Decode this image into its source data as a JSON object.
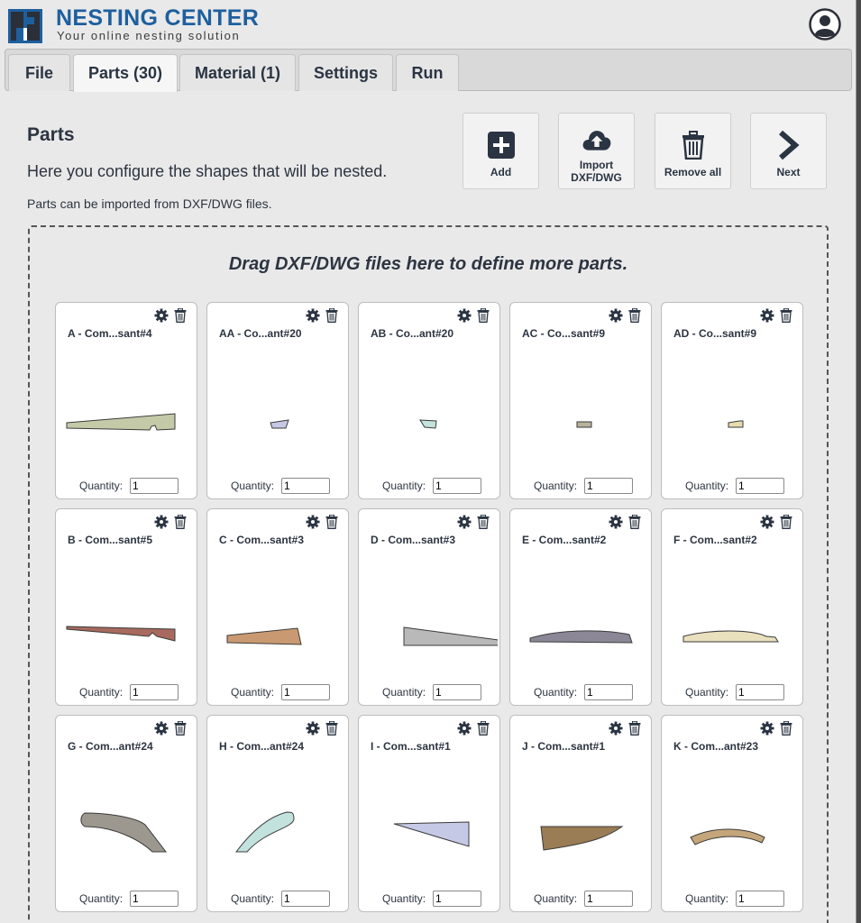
{
  "header": {
    "brand": "NESTING CENTER",
    "tagline": "Your online nesting solution"
  },
  "tabs": [
    {
      "label": "File"
    },
    {
      "label": "Parts (30)"
    },
    {
      "label": "Material (1)"
    },
    {
      "label": "Settings"
    },
    {
      "label": "Run"
    }
  ],
  "active_tab": "Parts (30)",
  "section": {
    "title": "Parts",
    "description": "Here you configure the shapes that will be nested.",
    "note": "Parts can be imported from DXF/DWG files."
  },
  "actions": [
    {
      "label": "Add",
      "icon": "plus-square-icon"
    },
    {
      "label": "Import\nDXF/DWG",
      "icon": "cloud-upload-icon"
    },
    {
      "label": "Remove all",
      "icon": "trash-icon"
    },
    {
      "label": "Next",
      "icon": "chevron-right-icon"
    }
  ],
  "dropzone": {
    "text": "Drag DXF/DWG files here to define more parts."
  },
  "parts": {
    "quantity_label": "Quantity:",
    "items": [
      {
        "name": "A - Com...sant#4",
        "quantity": "1",
        "color": "#c4c9a8"
      },
      {
        "name": "AA - Co...ant#20",
        "quantity": "1",
        "color": "#c7c8e6"
      },
      {
        "name": "AB - Co...ant#20",
        "quantity": "1",
        "color": "#c5e2dc"
      },
      {
        "name": "AC - Co...sant#9",
        "quantity": "1",
        "color": "#b8b39c"
      },
      {
        "name": "AD - Co...sant#9",
        "quantity": "1",
        "color": "#e6dcb0"
      },
      {
        "name": "B - Com...sant#5",
        "quantity": "1",
        "color": "#a86a5e"
      },
      {
        "name": "C - Com...sant#3",
        "quantity": "1",
        "color": "#c99a72"
      },
      {
        "name": "D - Com...sant#3",
        "quantity": "1",
        "color": "#b9b9ba"
      },
      {
        "name": "E - Com...sant#2",
        "quantity": "1",
        "color": "#8c8797"
      },
      {
        "name": "F - Com...sant#2",
        "quantity": "1",
        "color": "#e9e0be"
      },
      {
        "name": "G - Com...ant#24",
        "quantity": "1",
        "color": "#9c9890"
      },
      {
        "name": "H - Com...ant#24",
        "quantity": "1",
        "color": "#c2e2dd"
      },
      {
        "name": "I - Com...sant#1",
        "quantity": "1",
        "color": "#c6c9e6"
      },
      {
        "name": "J - Com...sant#1",
        "quantity": "1",
        "color": "#9a7c55"
      },
      {
        "name": "K - Com...ant#23",
        "quantity": "1",
        "color": "#c5a57a"
      }
    ]
  }
}
